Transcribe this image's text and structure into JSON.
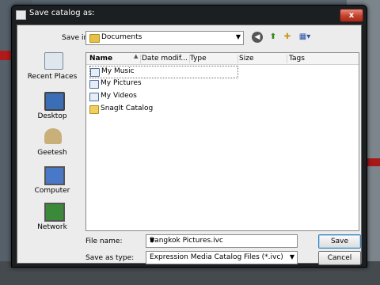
{
  "dialog": {
    "title": "Save catalog as:",
    "close_glyph": "x"
  },
  "toolbar": {
    "save_in_label": "Save in:",
    "save_in_value": "Documents",
    "back_icon": "back-arrow-icon",
    "up_icon": "up-folder-icon",
    "new_folder_icon": "new-folder-icon",
    "views_icon": "views-menu-icon"
  },
  "places": [
    {
      "label": "Recent Places"
    },
    {
      "label": "Desktop"
    },
    {
      "label": "Geetesh"
    },
    {
      "label": "Computer"
    },
    {
      "label": "Network"
    }
  ],
  "columns": {
    "name": "Name",
    "date": "Date modif...",
    "type": "Type",
    "size": "Size",
    "tags": "Tags"
  },
  "files": [
    {
      "name": "My Music",
      "icon": "music-folder-icon"
    },
    {
      "name": "My Pictures",
      "icon": "pictures-folder-icon"
    },
    {
      "name": "My Videos",
      "icon": "videos-folder-icon"
    },
    {
      "name": "SnagIt Catalog",
      "icon": "folder-icon"
    }
  ],
  "form": {
    "file_name_label": "File name:",
    "file_name_value": "Bangkok Pictures.ivc",
    "save_type_label": "Save as type:",
    "save_type_value": "Expression Media Catalog Files (*.ivc)"
  },
  "buttons": {
    "save": "Save",
    "cancel": "Cancel"
  }
}
